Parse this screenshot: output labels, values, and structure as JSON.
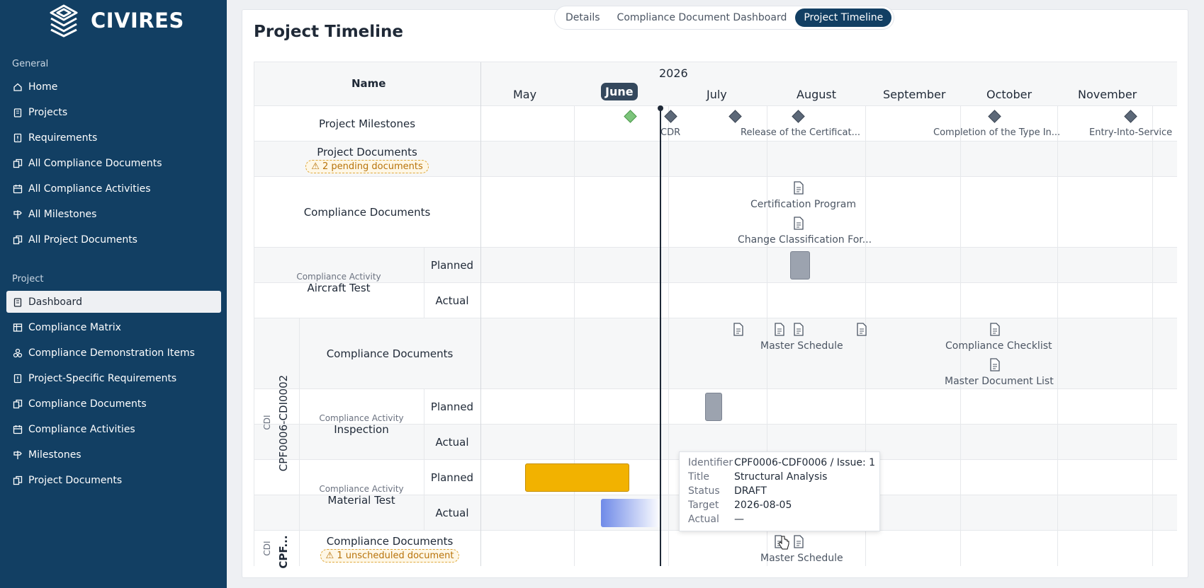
{
  "brand": {
    "name": "CIVIRES"
  },
  "sidebar": {
    "general_label": "General",
    "general_items": [
      {
        "label": "Home",
        "icon": "home-icon"
      },
      {
        "label": "Projects",
        "icon": "clipboard-icon"
      },
      {
        "label": "Requirements",
        "icon": "requirement-icon"
      },
      {
        "label": "All Compliance Documents",
        "icon": "documents-icon"
      },
      {
        "label": "All Compliance Activities",
        "icon": "calendar-icon"
      },
      {
        "label": "All Milestones",
        "icon": "signpost-icon"
      },
      {
        "label": "All Project Documents",
        "icon": "documents-icon"
      }
    ],
    "project_label": "Project",
    "project_items": [
      {
        "label": "Dashboard",
        "icon": "clipboard-icon",
        "active": true
      },
      {
        "label": "Compliance Matrix",
        "icon": "table-icon"
      },
      {
        "label": "Compliance Demonstration Items",
        "icon": "boxes-icon"
      },
      {
        "label": "Project-Specific Requirements",
        "icon": "requirement-icon"
      },
      {
        "label": "Compliance Documents",
        "icon": "documents-icon"
      },
      {
        "label": "Compliance Activities",
        "icon": "calendar-icon"
      },
      {
        "label": "Milestones",
        "icon": "signpost-icon"
      },
      {
        "label": "Project Documents",
        "icon": "documents-icon"
      }
    ]
  },
  "tabs": [
    {
      "label": "Details",
      "active": false
    },
    {
      "label": "Compliance Document Dashboard",
      "active": false
    },
    {
      "label": "Project Timeline",
      "active": true
    }
  ],
  "page_title": "Project Timeline",
  "timeline": {
    "name_header": "Name",
    "year": "2026",
    "months": [
      "May",
      "June",
      "July",
      "August",
      "September",
      "October",
      "November"
    ],
    "current_month": "June",
    "milestones_row": {
      "label": "Project Milestones",
      "items": [
        {
          "label": "CDR"
        },
        {
          "label": "Release of the Certificat..."
        },
        {
          "label": "Completion of the Type In..."
        },
        {
          "label": "Entry-Into-Service"
        }
      ]
    },
    "project_documents_row": {
      "label": "Project Documents",
      "badge": "2 pending documents"
    },
    "compliance_documents_row": {
      "label": "Compliance Documents",
      "docs": [
        "Certification Program",
        "Change Classification For..."
      ]
    },
    "aircraft_test": {
      "kind": "Compliance Activity",
      "name": "Aircraft Test",
      "planned": "Planned",
      "actual": "Actual"
    },
    "cdi_group_1": {
      "tag": "CDI",
      "id": "CPF0006-CDI0002",
      "compliance_documents": {
        "label": "Compliance Documents",
        "docs": [
          "Master Schedule",
          "Compliance Checklist",
          "Master Document List"
        ]
      },
      "inspection": {
        "kind": "Compliance Activity",
        "name": "Inspection",
        "planned": "Planned",
        "actual": "Actual"
      },
      "material_test": {
        "kind": "Compliance Activity",
        "name": "Material Test",
        "planned": "Planned",
        "actual": "Actual"
      }
    },
    "cdi_group_2": {
      "tag": "CDI",
      "id": "CPF...",
      "compliance_documents": {
        "label": "Compliance Documents",
        "badge": "1 unscheduled document",
        "docs": [
          "Master Schedule"
        ]
      }
    },
    "colors": {
      "planned_bar": "#f2b200",
      "inactive_bar": "#9ca3af",
      "actual_bar_start": "#6f8ae8",
      "milestone_done": "#7cc47b",
      "milestone": "#5c6878"
    }
  },
  "tooltip": {
    "identifier_label": "Identifier",
    "identifier": "CPF0006-CDF0006 / Issue: 1",
    "title_label": "Title",
    "title": "Structural Analysis",
    "status_label": "Status",
    "status": "DRAFT",
    "target_label": "Target",
    "target": "2026-08-05",
    "actual_label": "Actual",
    "actual": "—"
  }
}
